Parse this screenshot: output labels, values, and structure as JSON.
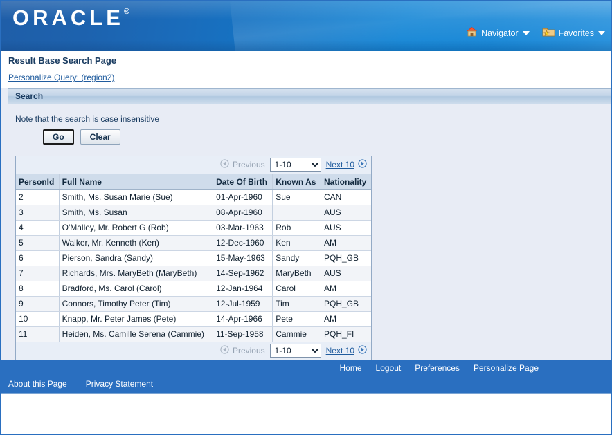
{
  "branding": {
    "logo_text": "ORACLE",
    "registered_mark": "®"
  },
  "global_nav": {
    "navigator": {
      "label": "Navigator",
      "icon": "home-icon",
      "caret": "chevron-down-icon"
    },
    "favorites": {
      "label": "Favorites",
      "icon": "folder-star-icon",
      "caret": "chevron-down-icon"
    }
  },
  "page": {
    "title": "Result Base Search Page",
    "personalize_link": "Personalize Query: (region2)"
  },
  "search_region": {
    "header": "Search",
    "note": "Note that the search is case insensitive",
    "go_button": "Go",
    "clear_button": "Clear"
  },
  "pagination": {
    "previous_label": "Previous",
    "previous_icon": "circle-arrow-left-icon",
    "next_label": "Next 10",
    "next_icon": "circle-arrow-right-icon",
    "range_value": "1-10",
    "range_options": [
      "1-10"
    ]
  },
  "table": {
    "columns": [
      "PersonId",
      "Full Name",
      "Date Of Birth",
      "Known As",
      "Nationality"
    ],
    "rows": [
      {
        "person_id": "2",
        "full_name": "Smith, Ms. Susan Marie (Sue)",
        "dob": "01-Apr-1960",
        "known_as": "Sue",
        "nationality": "CAN"
      },
      {
        "person_id": "3",
        "full_name": "Smith, Ms. Susan",
        "dob": "08-Apr-1960",
        "known_as": "",
        "nationality": "AUS"
      },
      {
        "person_id": "4",
        "full_name": "O'Malley, Mr. Robert G (Rob)",
        "dob": "03-Mar-1963",
        "known_as": "Rob",
        "nationality": "AUS"
      },
      {
        "person_id": "5",
        "full_name": "Walker, Mr. Kenneth (Ken)",
        "dob": "12-Dec-1960",
        "known_as": "Ken",
        "nationality": "AM"
      },
      {
        "person_id": "6",
        "full_name": "Pierson, Sandra (Sandy)",
        "dob": "15-May-1963",
        "known_as": "Sandy",
        "nationality": "PQH_GB"
      },
      {
        "person_id": "7",
        "full_name": "Richards, Mrs. MaryBeth (MaryBeth)",
        "dob": "14-Sep-1962",
        "known_as": "MaryBeth",
        "nationality": "AUS"
      },
      {
        "person_id": "8",
        "full_name": "Bradford, Ms. Carol (Carol)",
        "dob": "12-Jan-1964",
        "known_as": "Carol",
        "nationality": "AM"
      },
      {
        "person_id": "9",
        "full_name": "Connors, Timothy Peter (Tim)",
        "dob": "12-Jul-1959",
        "known_as": "Tim",
        "nationality": "PQH_GB"
      },
      {
        "person_id": "10",
        "full_name": "Knapp, Mr. Peter James (Pete)",
        "dob": "14-Apr-1966",
        "known_as": "Pete",
        "nationality": "AM"
      },
      {
        "person_id": "11",
        "full_name": "Heiden, Ms. Camille Serena (Cammie)",
        "dob": "11-Sep-1958",
        "known_as": "Cammie",
        "nationality": "PQH_FI"
      }
    ]
  },
  "footer": {
    "primary_links": [
      "Home",
      "Logout",
      "Preferences",
      "Personalize Page"
    ],
    "secondary_links": [
      "About this Page",
      "Privacy Statement"
    ]
  },
  "colors": {
    "brand_blue_dark": "#1f5ea8",
    "brand_blue_light": "#0b81d4",
    "footer_blue": "#2a6fc0",
    "link_blue": "#205c9e",
    "content_bg": "#e8ecf5",
    "table_header_bg": "#cfdceb"
  }
}
